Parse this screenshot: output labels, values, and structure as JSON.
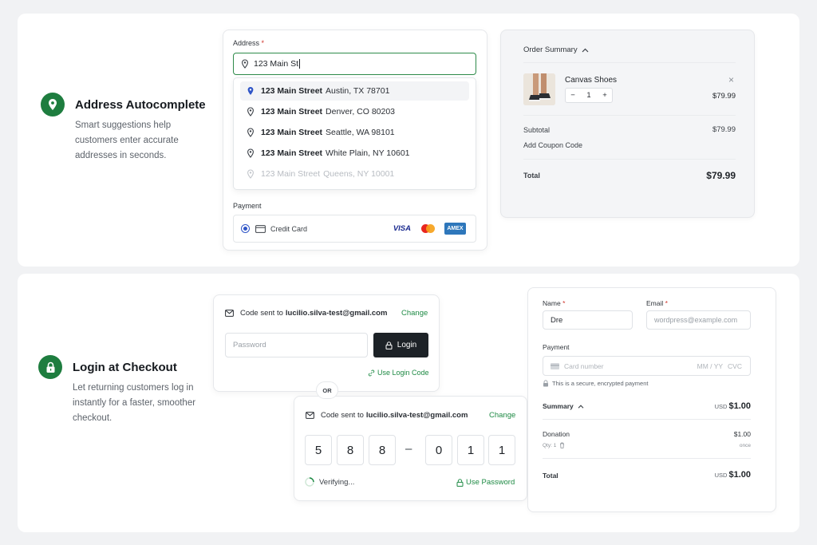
{
  "feature_address": {
    "title": "Address Autocomplete",
    "desc": "Smart suggestions help customers enter accurate addresses in seconds."
  },
  "address": {
    "label": "Address",
    "required_mark": "*",
    "value": "123 Main St",
    "suggestions": [
      {
        "street": "123 Main Street",
        "place": "Austin, TX 78701"
      },
      {
        "street": "123 Main Street",
        "place": "Denver, CO 80203"
      },
      {
        "street": "123 Main Street",
        "place": "Seattle, WA 98101"
      },
      {
        "street": "123 Main Street",
        "place": "White Plain, NY 10601"
      },
      {
        "street": "123 Main Street",
        "place": "Queens, NY 10001"
      }
    ]
  },
  "payment": {
    "label": "Payment",
    "method": "Credit Card",
    "brands": [
      "VISA",
      "Mastercard",
      "AMEX"
    ],
    "visa": "VISA",
    "amex": "AMEX"
  },
  "order_summary": {
    "title": "Order Summary",
    "product_name": "Canvas Shoes",
    "qty": "1",
    "qty_minus": "−",
    "qty_plus": "+",
    "remove": "×",
    "price": "$79.99",
    "subtotal_label": "Subtotal",
    "subtotal": "$79.99",
    "coupon": "Add Coupon Code",
    "total_label": "Total",
    "total": "$79.99"
  },
  "feature_login": {
    "title": "Login at Checkout",
    "desc": "Let returning customers log in instantly for a faster, smoother checkout."
  },
  "login_card": {
    "code_sent_prefix": "Code sent to",
    "email": "lucilio.silva-test@gmail.com",
    "change": "Change",
    "password_placeholder": "Password",
    "login_button": "Login",
    "use_login_code": "Use Login Code"
  },
  "or_label": "OR",
  "code_card": {
    "code_sent_prefix": "Code sent to",
    "email": "lucilio.silva-test@gmail.com",
    "change": "Change",
    "digits": [
      "5",
      "8",
      "8",
      "0",
      "1",
      "1"
    ],
    "dash": "–",
    "verifying": "Verifying...",
    "use_password": "Use Password"
  },
  "donation_form": {
    "name_label": "Name",
    "name_value": "Dre",
    "email_label": "Email",
    "email_placeholder": "wordpress@example.com",
    "payment_label": "Payment",
    "card_placeholder": "Card number",
    "expiry_placeholder": "MM / YY",
    "cvc_placeholder": "CVC",
    "secure_note": "This is a secure, encrypted payment",
    "summary_label": "Summary",
    "summary_currency": "USD",
    "summary_amount": "$1.00",
    "item_name": "Donation",
    "item_amount": "$1.00",
    "item_qty": "Qty: 1",
    "item_frequency": "once",
    "total_label": "Total",
    "total_currency": "USD",
    "total_amount": "$1.00"
  },
  "colors": {
    "accent": "#1e7d3f",
    "dark_button": "#1d2227",
    "bg": "#f1f2f4"
  }
}
